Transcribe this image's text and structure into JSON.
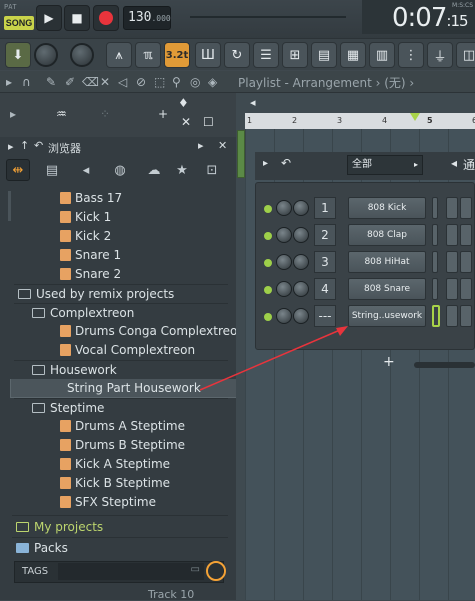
{
  "transport": {
    "pat_label": "PAT",
    "song_label": "SONG",
    "tempo": "130",
    "tempo_decimals": ".000",
    "time": "0:07",
    "time_sub": ":15",
    "time_label": "M:S:CS"
  },
  "toolbar": {
    "snap_label": "3.2t"
  },
  "row3": {
    "playlist_title": "Playlist - Arrangement › (无) ›"
  },
  "browser": {
    "title": "浏览器",
    "items": [
      {
        "type": "audio",
        "label": "Bass 17",
        "indent": 3
      },
      {
        "type": "audio",
        "label": "Kick 1",
        "indent": 3
      },
      {
        "type": "audio",
        "label": "Kick 2",
        "indent": 3
      },
      {
        "type": "audio",
        "label": "Snare 1",
        "indent": 3
      },
      {
        "type": "audio",
        "label": "Snare 2",
        "indent": 3
      },
      {
        "type": "folder",
        "label": "Used by remix projects",
        "indent": 1
      },
      {
        "type": "folder",
        "label": "Complextreon",
        "indent": 2
      },
      {
        "type": "audio",
        "label": "Drums Conga Complextreon",
        "indent": 3
      },
      {
        "type": "audio",
        "label": "Vocal Complextreon",
        "indent": 3
      },
      {
        "type": "folder",
        "label": "Housework",
        "indent": 2
      },
      {
        "type": "audio",
        "label": "String Part Housework",
        "indent": 3,
        "selected": true
      },
      {
        "type": "folder",
        "label": "Steptime",
        "indent": 2
      },
      {
        "type": "audio",
        "label": "Drums A Steptime",
        "indent": 3
      },
      {
        "type": "audio",
        "label": "Drums B Steptime",
        "indent": 3
      },
      {
        "type": "audio",
        "label": "Kick A Steptime",
        "indent": 3
      },
      {
        "type": "audio",
        "label": "Kick B Steptime",
        "indent": 3
      },
      {
        "type": "audio",
        "label": "SFX Steptime",
        "indent": 3
      }
    ],
    "my_projects": "My projects",
    "packs": "Packs",
    "tags_label": "TAGS"
  },
  "playlist": {
    "ruler_marks": [
      "1",
      "2",
      "3",
      "4",
      "5",
      "6"
    ],
    "track_label": "Track 10"
  },
  "channel_rack": {
    "filter_label": "全部",
    "channels": [
      {
        "num": "1",
        "name": "808 Kick"
      },
      {
        "num": "2",
        "name": "808 Clap"
      },
      {
        "num": "3",
        "name": "808 HiHat"
      },
      {
        "num": "4",
        "name": "808 Snare"
      },
      {
        "num": "---",
        "name": "String..usework"
      }
    ],
    "add_label": "+",
    "cut_label": "通"
  },
  "colors": {
    "accent": "#f4a236",
    "song": "#c9d34a",
    "led": "#9ed04a",
    "arrow": "#e8343c"
  }
}
